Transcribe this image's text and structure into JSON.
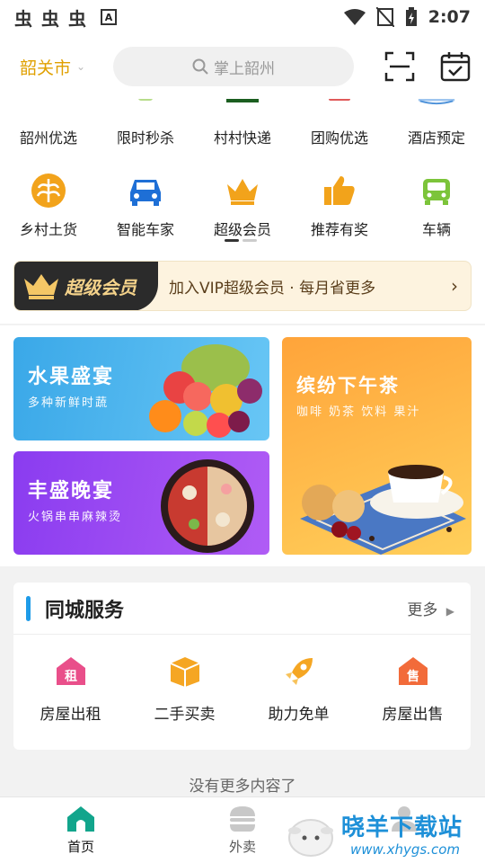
{
  "status_bar": {
    "time": "2:07",
    "left_glyphs": [
      "虫",
      "虫",
      "虫"
    ],
    "a_badge": "A"
  },
  "top_bar": {
    "city": "韶关市",
    "search_placeholder": "掌上韶州"
  },
  "grid": {
    "row1": [
      {
        "label": "韶州优选",
        "icon": "basket-icon",
        "color": "#e07878"
      },
      {
        "label": "限时秒杀",
        "icon": "flash-sale-icon",
        "color": "#8bc34a"
      },
      {
        "label": "村村快递",
        "icon": "truck-icon",
        "color": "#2e7d32"
      },
      {
        "label": "团购优选",
        "icon": "group-buy-icon",
        "color": "#e05a5a"
      },
      {
        "label": "酒店预定",
        "icon": "hotel-icon",
        "color": "#4a90d9"
      }
    ],
    "row2": [
      {
        "label": "乡村土货",
        "icon": "wheat-icon",
        "color": "#f2a31b"
      },
      {
        "label": "智能车家",
        "icon": "car-icon",
        "color": "#1e6fd6"
      },
      {
        "label": "超级会员",
        "icon": "crown-icon",
        "color": "#f2a31b"
      },
      {
        "label": "推荐有奖",
        "icon": "thumbs-up-icon",
        "color": "#f2a31b"
      },
      {
        "label": "车辆",
        "icon": "vehicle-icon",
        "color": "#7cc43a"
      }
    ]
  },
  "vip": {
    "badge": "超级会员",
    "text": "加入VIP超级会员 · 每月省更多"
  },
  "promos": {
    "fruit": {
      "title": "水果盛宴",
      "subtitle": "多种新鲜时蔬"
    },
    "dinner": {
      "title": "丰盛晚宴",
      "subtitle": "火锅串串麻辣烫"
    },
    "tea": {
      "title": "缤纷下午茶",
      "subtitle": "咖啡 奶茶 饮料 果汁"
    }
  },
  "service": {
    "title": "同城服务",
    "more": "更多",
    "items": [
      {
        "label": "房屋出租",
        "icon": "rent-icon",
        "glyph": "租",
        "color": "#e94f8a"
      },
      {
        "label": "二手买卖",
        "icon": "box-icon",
        "glyph": "",
        "color": "#f5a623"
      },
      {
        "label": "助力免单",
        "icon": "rocket-icon",
        "glyph": "",
        "color": "#f5a623"
      },
      {
        "label": "房屋出售",
        "icon": "sale-icon",
        "glyph": "售",
        "color": "#f26b3a"
      }
    ]
  },
  "footer_note": "没有更多内容了",
  "bottom_nav": [
    {
      "label": "首页",
      "icon": "home-icon",
      "active": true
    },
    {
      "label": "外卖",
      "icon": "burger-icon",
      "active": false
    }
  ],
  "watermark": {
    "title": "晓羊下载站",
    "url": "www.xhygs.com"
  },
  "colors": {
    "accent_blue": "#1e9be8",
    "city_gold": "#e0a000",
    "nav_active": "#12a58c"
  }
}
